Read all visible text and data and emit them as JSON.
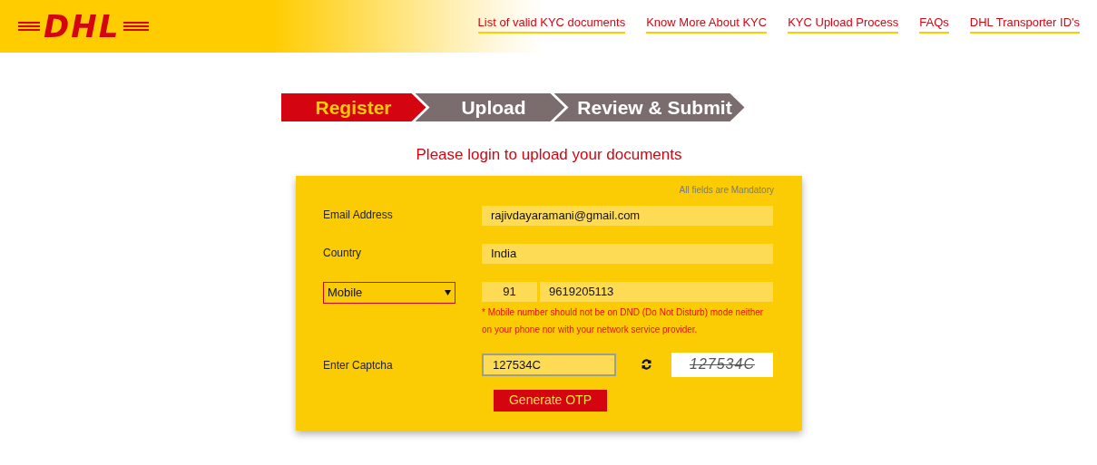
{
  "logo": {
    "text": "DHL"
  },
  "nav_links": [
    "List of valid KYC documents",
    "Know More About KYC",
    "KYC Upload Process",
    "FAQs",
    "DHL Transporter ID's"
  ],
  "steps": [
    {
      "label": "Register",
      "selected": true
    },
    {
      "label": "Upload",
      "selected": false
    },
    {
      "label": "Review & Submit",
      "selected": false
    }
  ],
  "heading": "Please login to upload your documents",
  "form": {
    "note": "All fields are Mandatory",
    "email": {
      "label": "Email Address",
      "value": "rajivdayaramani@gmail.com"
    },
    "country": {
      "label": "Country",
      "value": "India"
    },
    "phone": {
      "type_select": "Mobile",
      "code": "91",
      "number": "9619205113"
    },
    "warning": "* Mobile number should not be on DND (Do Not Disturb) mode neither on your phone nor with your network service provider.",
    "captcha": {
      "label": "Enter Captcha",
      "value": "127534C",
      "image_text": "127534C"
    },
    "submit": "Generate OTP"
  }
}
